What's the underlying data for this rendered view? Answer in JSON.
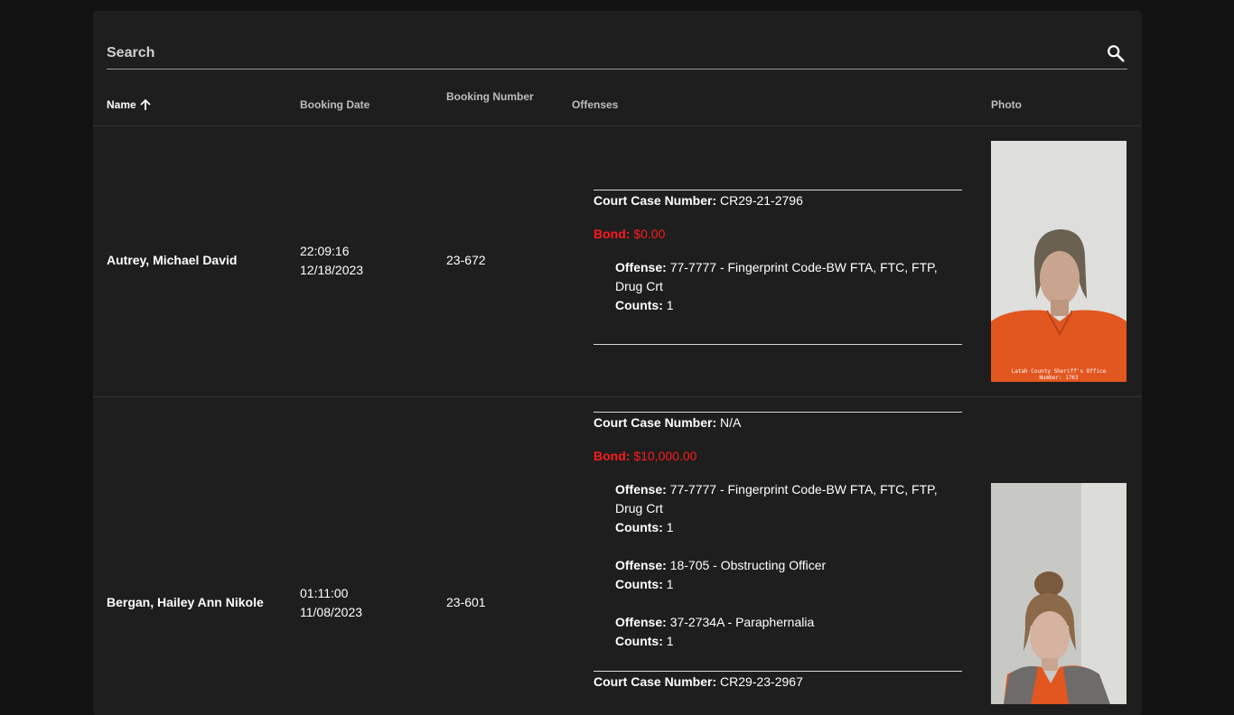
{
  "search": {
    "placeholder": "Search",
    "icon": "search-icon"
  },
  "table": {
    "headers": {
      "name": "Name",
      "booking_date": "Booking Date",
      "booking_number": "Booking Number",
      "offenses": "Offenses",
      "photo": "Photo"
    },
    "sort_icon": "arrow-up-icon",
    "labels": {
      "court_case": "Court Case Number:",
      "bond": "Bond:",
      "offense": "Offense:",
      "counts": "Counts:"
    },
    "rows": [
      {
        "name": "Autrey, Michael David",
        "time": "22:09:16",
        "date": "12/18/2023",
        "booking_number": "23-672",
        "cases": [
          {
            "court_case": "CR29-21-2796",
            "bond": "$0.00",
            "offenses": [
              {
                "offense": "77-7777 - Fingerprint Code-BW FTA, FTC, FTP, Drug Crt",
                "counts": "1"
              }
            ]
          }
        ],
        "photo_caption_line1": "Latah County Sheriff's Office",
        "photo_caption_line2": "Number: 1763"
      },
      {
        "name": "Bergan, Hailey Ann Nikole",
        "time": "01:11:00",
        "date": "11/08/2023",
        "booking_number": "23-601",
        "cases": [
          {
            "court_case": "N/A",
            "bond": "$10,000.00",
            "offenses": [
              {
                "offense": "77-7777 - Fingerprint Code-BW FTA, FTC, FTP, Drug Crt",
                "counts": "1"
              },
              {
                "offense": "18-705 - Obstructing Officer",
                "counts": "1"
              },
              {
                "offense": "37-2734A - Paraphernalia",
                "counts": "1"
              }
            ]
          },
          {
            "court_case": "CR29-23-2967"
          }
        ]
      }
    ]
  },
  "colors": {
    "page_bg": "#121212",
    "panel_bg": "#1e1e1e",
    "bond_red": "#ff1a1a",
    "prison_orange": "#e2561f"
  }
}
